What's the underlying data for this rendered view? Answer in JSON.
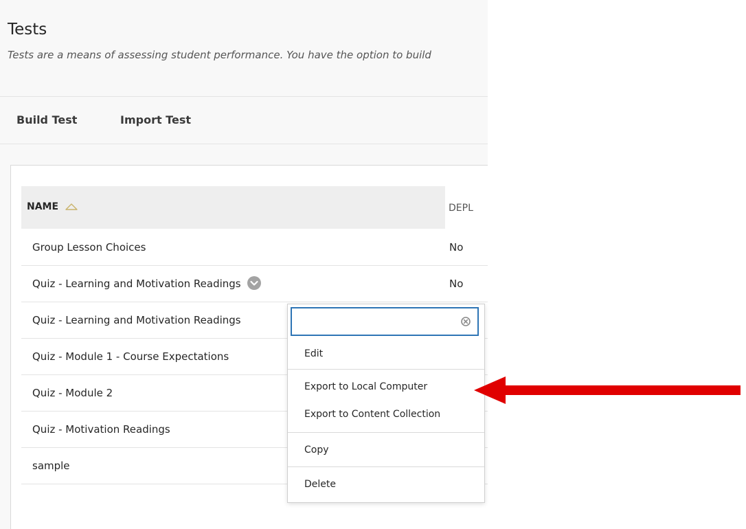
{
  "page": {
    "title": "Tests",
    "description": "Tests are a means of assessing student performance. You have the option to build"
  },
  "toolbar": {
    "build_label": "Build Test",
    "import_label": "Import Test"
  },
  "table": {
    "columns": {
      "name": "NAME",
      "deployed": "DEPL"
    },
    "rows": [
      {
        "name": "Group Lesson Choices",
        "deployed": "No"
      },
      {
        "name": "Quiz - Learning and Motivation Readings",
        "deployed": "No"
      },
      {
        "name": "Quiz - Learning and Motivation Readings",
        "deployed": ""
      },
      {
        "name": "Quiz - Module 1 - Course Expectations",
        "deployed": ""
      },
      {
        "name": "Quiz - Module 2",
        "deployed": ""
      },
      {
        "name": "Quiz - Motivation Readings",
        "deployed": ""
      },
      {
        "name": "sample",
        "deployed": ""
      }
    ]
  },
  "context_menu": {
    "search_value": "",
    "items": [
      "Edit",
      "Export to Local Computer",
      "Export to Content Collection",
      "Copy",
      "Delete"
    ]
  },
  "colors": {
    "focus_border": "#2d74b5",
    "annotation_arrow": "#e00000"
  },
  "icons": {
    "sort": "triangle-up-outline-icon",
    "row_menu": "chevron-down-circle-icon",
    "clear": "clear-circle-icon",
    "annotation": "red-arrow-left-icon"
  }
}
